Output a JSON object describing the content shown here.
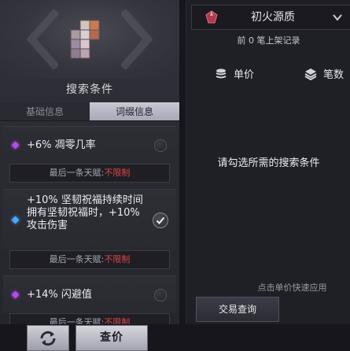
{
  "search_panel": {
    "title": "搜索条件",
    "tabs": [
      {
        "label": "基础信息",
        "active": false
      },
      {
        "label": "词缀信息",
        "active": true
      }
    ],
    "affixes": [
      {
        "rarity": "purple",
        "text": "+6% 凋零几率",
        "checked": false
      },
      {
        "rarity": "blue",
        "text": "+10% 坚韧祝福持续时间 拥有坚韧祝福时，+10% 攻击伤害",
        "checked": true
      },
      {
        "rarity": "purple",
        "text": "+14% 闪避值",
        "checked": false
      }
    ],
    "last_talent": {
      "label": "最后一条天赋:",
      "value": "不限制"
    },
    "refresh_icon": "refresh-icon",
    "search_button": "查价"
  },
  "market_panel": {
    "category": "初火源质",
    "record_count": "前 0 笔上架记录",
    "columns": {
      "price": "单价",
      "count": "笔数"
    },
    "empty_hint": "请勾选所需的搜索条件",
    "quick_hint": "点击单价快速应用",
    "trade_button": "交易查询"
  },
  "colors": {
    "purple_affix": "#b04ce8",
    "blue_affix": "#49a6ff",
    "unlimited_red": "#d84848"
  }
}
